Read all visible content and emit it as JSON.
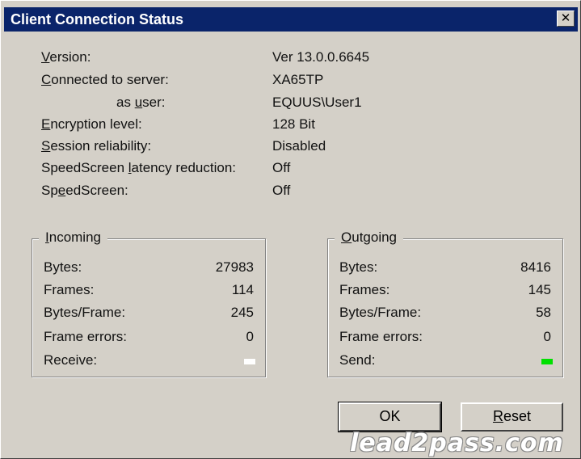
{
  "window": {
    "title": "Client Connection Status",
    "close_glyph": "✕"
  },
  "info": {
    "version": {
      "label_pre": "",
      "label_u": "V",
      "label_post": "ersion:",
      "value": "Ver 13.0.0.6645"
    },
    "server": {
      "label_pre": "",
      "label_u": "C",
      "label_post": "onnected to server:",
      "value": "XA65TP"
    },
    "user": {
      "label_pre": "as ",
      "label_u": "u",
      "label_post": "ser:",
      "value": "EQUUS\\User1"
    },
    "encryption": {
      "label_pre": "",
      "label_u": "E",
      "label_post": "ncryption level:",
      "value": "128 Bit"
    },
    "reliability": {
      "label_pre": "",
      "label_u": "S",
      "label_post": "ession reliability:",
      "value": "Disabled"
    },
    "latency": {
      "label_pre": "SpeedScreen ",
      "label_u": "l",
      "label_post": "atency reduction:",
      "value": "Off"
    },
    "speedscreen": {
      "label_pre": "Sp",
      "label_u": "e",
      "label_post": "edScreen:",
      "value": "Off"
    }
  },
  "incoming": {
    "title_u": "I",
    "title_post": "ncoming",
    "bytes_label": "Bytes:",
    "bytes": "27983",
    "frames_label": "Frames:",
    "frames": "114",
    "bpf_label": "Bytes/Frame:",
    "bpf": "245",
    "errors_label": "Frame errors:",
    "errors": "0",
    "indicator_label": "Receive:",
    "indicator_color": "#ffffff"
  },
  "outgoing": {
    "title_u": "O",
    "title_post": "utgoing",
    "bytes_label": "Bytes:",
    "bytes": "8416",
    "frames_label": "Frames:",
    "frames": "145",
    "bpf_label": "Bytes/Frame:",
    "bpf": "58",
    "errors_label": "Frame errors:",
    "errors": "0",
    "indicator_label": "Send:",
    "indicator_color": "#00e000"
  },
  "buttons": {
    "ok_label": "OK",
    "reset_u": "R",
    "reset_post": "eset"
  },
  "watermark": "lead2pass.com"
}
